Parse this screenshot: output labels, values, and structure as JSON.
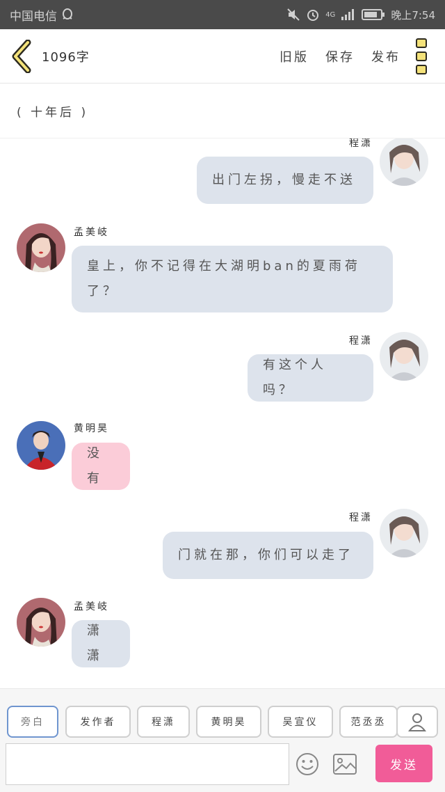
{
  "status_bar": {
    "carrier": "中国电信",
    "network": "4G",
    "time": "晚上7:54"
  },
  "header": {
    "title": "1096字",
    "actions": [
      "旧版",
      "保存",
      "发布"
    ]
  },
  "scene": "( 十年后 )",
  "messages": [
    {
      "side": "right",
      "name": "程潇",
      "text": "出门左拐，慢走不送"
    },
    {
      "side": "left",
      "name": "孟美岐",
      "text": "皇上，你不记得在大湖明ban的夏雨荷了？"
    },
    {
      "side": "right",
      "name": "程潇",
      "text": "有这个人吗？"
    },
    {
      "side": "left",
      "name": "黄明昊",
      "text": "没有"
    },
    {
      "side": "right",
      "name": "程潇",
      "text": "门就在那，你们可以走了"
    },
    {
      "side": "left",
      "name": "孟美岐",
      "text": "潇潇"
    }
  ],
  "roles": [
    "旁白",
    "发作者",
    "程潇",
    "黄明昊",
    "吴宣仪",
    "范丞丞"
  ],
  "input": {
    "placeholder": ""
  },
  "send_label": "发送",
  "colors": {
    "bubble_gray": "#dde3ec",
    "bubble_pink": "#fbccd8",
    "send": "#f15c98",
    "active_role_border": "#6f95cf"
  }
}
